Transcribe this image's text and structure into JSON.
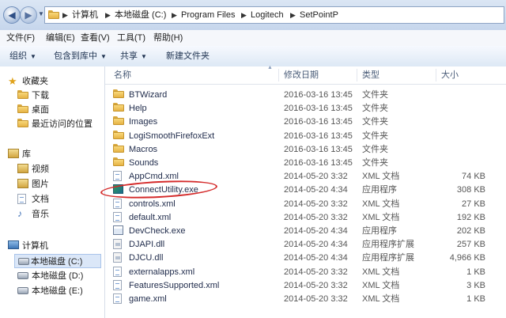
{
  "address": {
    "breadcrumbs": [
      "计算机",
      "本地磁盘 (C:)",
      "Program Files",
      "Logitech",
      "SetPointP"
    ]
  },
  "menu": [
    "文件(F)",
    "编辑(E)",
    "查看(V)",
    "工具(T)",
    "帮助(H)"
  ],
  "toolbar": {
    "organize": "组织",
    "include_library": "包含到库中",
    "share": "共享",
    "new_folder": "新建文件夹"
  },
  "nav": {
    "favorites": {
      "title": "收藏夹",
      "items": [
        "下载",
        "桌面",
        "最近访问的位置"
      ]
    },
    "libraries": {
      "title": "库",
      "items": [
        "视频",
        "图片",
        "文档",
        "音乐"
      ]
    },
    "computer": {
      "title": "计算机",
      "items": [
        "本地磁盘 (C:)",
        "本地磁盘 (D:)",
        "本地磁盘 (E:)"
      ]
    }
  },
  "columns": {
    "name": "名称",
    "date": "修改日期",
    "type": "类型",
    "size": "大小"
  },
  "files": [
    {
      "name": "BTWizard",
      "date": "2016-03-16 13:45",
      "type": "文件夹",
      "size": "",
      "icon": "folder"
    },
    {
      "name": "Help",
      "date": "2016-03-16 13:45",
      "type": "文件夹",
      "size": "",
      "icon": "folder"
    },
    {
      "name": "Images",
      "date": "2016-03-16 13:45",
      "type": "文件夹",
      "size": "",
      "icon": "folder"
    },
    {
      "name": "LogiSmoothFirefoxExt",
      "date": "2016-03-16 13:45",
      "type": "文件夹",
      "size": "",
      "icon": "folder"
    },
    {
      "name": "Macros",
      "date": "2016-03-16 13:45",
      "type": "文件夹",
      "size": "",
      "icon": "folder"
    },
    {
      "name": "Sounds",
      "date": "2016-03-16 13:45",
      "type": "文件夹",
      "size": "",
      "icon": "folder"
    },
    {
      "name": "AppCmd.xml",
      "date": "2014-05-20 3:32",
      "type": "XML 文档",
      "size": "74 KB",
      "icon": "xml"
    },
    {
      "name": "ConnectUtility.exe",
      "date": "2014-05-20 4:34",
      "type": "应用程序",
      "size": "308 KB",
      "icon": "exe-green"
    },
    {
      "name": "controls.xml",
      "date": "2014-05-20 3:32",
      "type": "XML 文档",
      "size": "27 KB",
      "icon": "xml"
    },
    {
      "name": "default.xml",
      "date": "2014-05-20 3:32",
      "type": "XML 文档",
      "size": "192 KB",
      "icon": "xml"
    },
    {
      "name": "DevCheck.exe",
      "date": "2014-05-20 4:34",
      "type": "应用程序",
      "size": "202 KB",
      "icon": "exe"
    },
    {
      "name": "DJAPI.dll",
      "date": "2014-05-20 4:34",
      "type": "应用程序扩展",
      "size": "257 KB",
      "icon": "dll"
    },
    {
      "name": "DJCU.dll",
      "date": "2014-05-20 4:34",
      "type": "应用程序扩展",
      "size": "4,966 KB",
      "icon": "dll"
    },
    {
      "name": "externalapps.xml",
      "date": "2014-05-20 3:32",
      "type": "XML 文档",
      "size": "1 KB",
      "icon": "xml"
    },
    {
      "name": "FeaturesSupported.xml",
      "date": "2014-05-20 3:32",
      "type": "XML 文档",
      "size": "3 KB",
      "icon": "xml"
    },
    {
      "name": "game.xml",
      "date": "2014-05-20 3:32",
      "type": "XML 文档",
      "size": "1 KB",
      "icon": "xml"
    }
  ],
  "highlight_color": "#d42a2a"
}
